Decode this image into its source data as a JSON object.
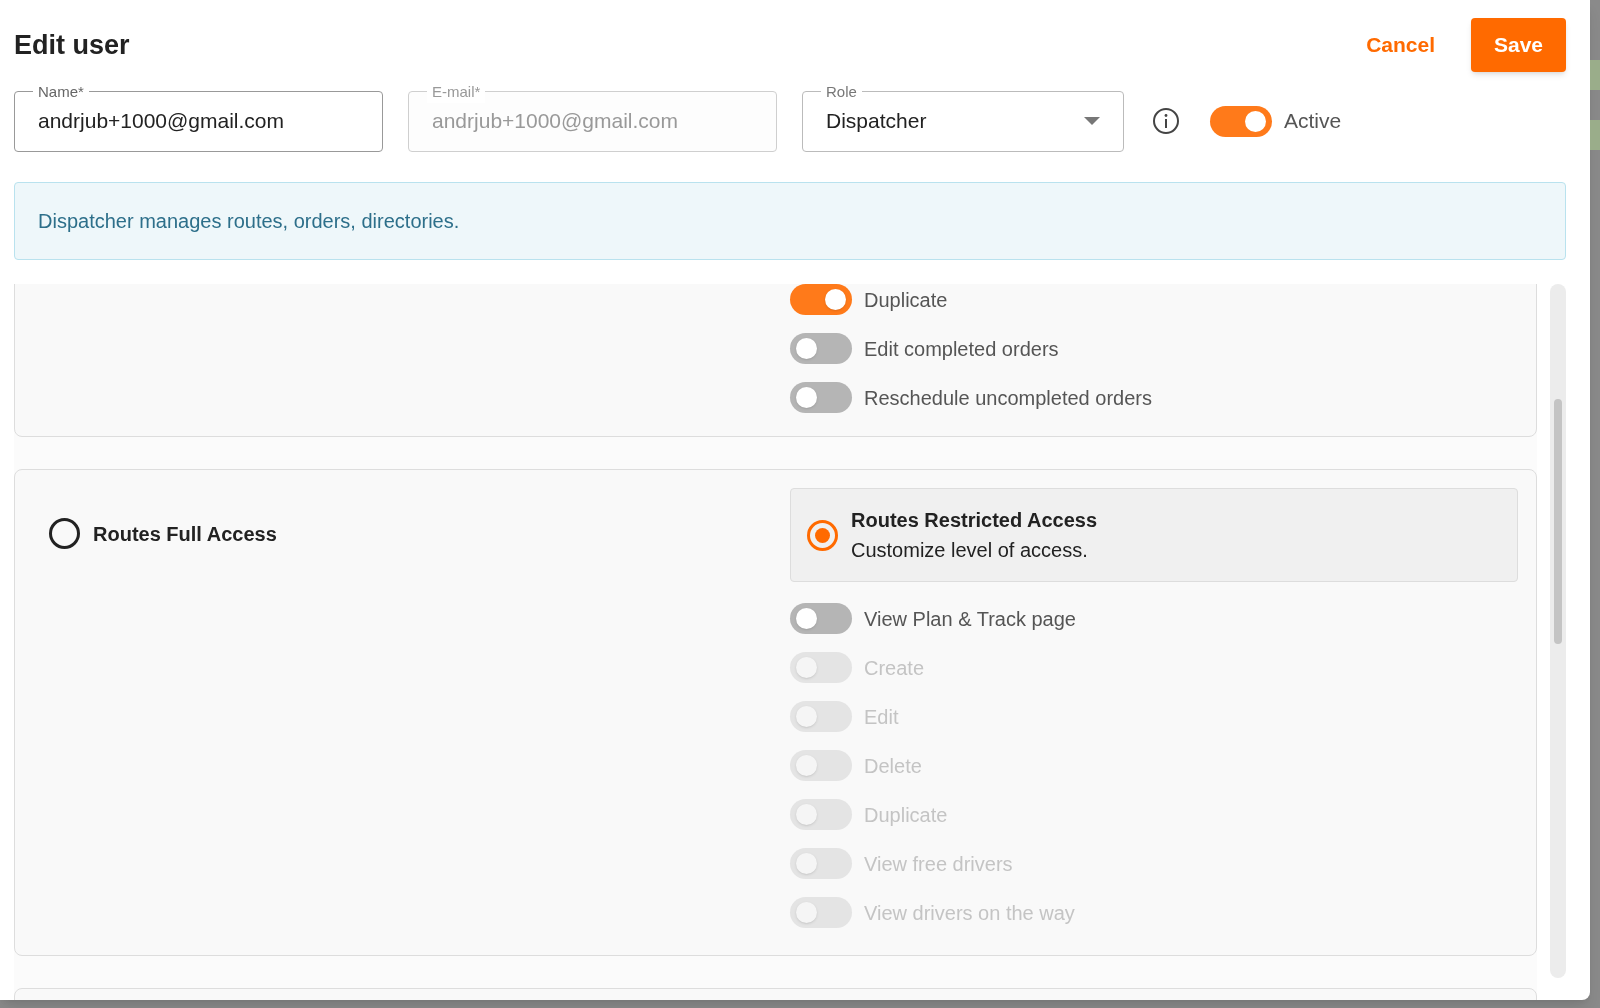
{
  "dialog": {
    "title": "Edit user",
    "cancel": "Cancel",
    "save": "Save"
  },
  "fields": [
    {
      "label": "Name*",
      "value": "andrjub+1000@gmail.com",
      "disabled": false
    },
    {
      "label": "E-mail*",
      "value": "andrjub+1000@gmail.com",
      "disabled": true
    }
  ],
  "role": {
    "label": "Role",
    "value": "Dispatcher"
  },
  "active": {
    "label": "Active",
    "on": true
  },
  "info": "Dispatcher manages routes, orders, directories.",
  "orders_section": {
    "toggles": [
      {
        "label": "Duplicate",
        "on": true,
        "disabled": false
      },
      {
        "label": "Edit completed orders",
        "on": false,
        "disabled": false
      },
      {
        "label": "Reschedule uncompleted orders",
        "on": false,
        "disabled": false
      }
    ]
  },
  "routes_section": {
    "options": [
      {
        "title": "Routes Full Access",
        "selected": false
      },
      {
        "title": "Routes Restricted Access",
        "subtitle": "Customize level of access.",
        "selected": true
      }
    ],
    "toggles": [
      {
        "label": "View Plan & Track page",
        "on": false,
        "disabled": false
      },
      {
        "label": "Create",
        "on": false,
        "disabled": true
      },
      {
        "label": "Edit",
        "on": false,
        "disabled": true
      },
      {
        "label": "Delete",
        "on": false,
        "disabled": true
      },
      {
        "label": "Duplicate",
        "on": false,
        "disabled": true
      },
      {
        "label": "View free drivers",
        "on": false,
        "disabled": true
      },
      {
        "label": "View drivers on the way",
        "on": false,
        "disabled": true
      }
    ]
  }
}
